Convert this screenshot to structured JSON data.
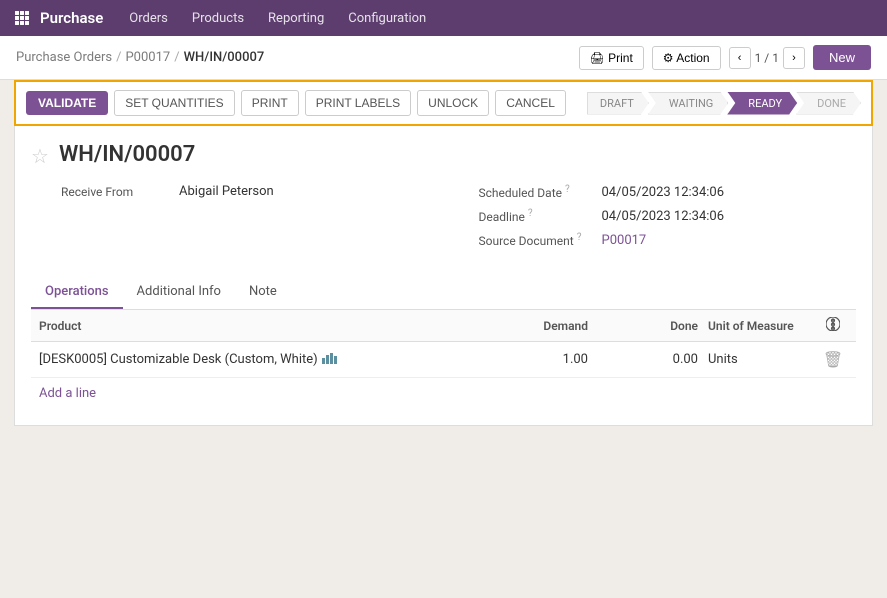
{
  "app": {
    "name": "Purchase"
  },
  "topnav": {
    "items": [
      {
        "label": "Orders",
        "id": "orders"
      },
      {
        "label": "Products",
        "id": "products"
      },
      {
        "label": "Reporting",
        "id": "reporting"
      },
      {
        "label": "Configuration",
        "id": "configuration"
      }
    ]
  },
  "breadcrumb": {
    "items": [
      {
        "label": "Purchase Orders",
        "href": "#"
      },
      {
        "label": "P00017",
        "href": "#"
      },
      {
        "label": "WH/IN/00007"
      }
    ],
    "separator": "/"
  },
  "header_actions": {
    "print_label": "🖨 Print",
    "action_label": "⚙ Action",
    "pager": "1 / 1",
    "new_label": "New"
  },
  "action_buttons": {
    "validate": "VALIDATE",
    "set_quantities": "SET QUANTITIES",
    "print": "PRINT",
    "print_labels": "PRINT LABELS",
    "unlock": "UNLOCK",
    "cancel": "CANCEL"
  },
  "status_pipeline": [
    {
      "label": "DRAFT",
      "state": "draft"
    },
    {
      "label": "WAITING",
      "state": "waiting"
    },
    {
      "label": "READY",
      "state": "active"
    },
    {
      "label": "DONE",
      "state": "done"
    }
  ],
  "record": {
    "title": "WH/IN/00007",
    "receive_from_label": "Receive From",
    "receive_from_value": "Abigail Peterson",
    "scheduled_date_label": "Scheduled Date",
    "scheduled_date_value": "04/05/2023 12:34:06",
    "deadline_label": "Deadline",
    "deadline_value": "04/05/2023 12:34:06",
    "source_document_label": "Source Document",
    "source_document_value": "P00017"
  },
  "tabs": [
    {
      "label": "Operations",
      "id": "operations",
      "active": true
    },
    {
      "label": "Additional Info",
      "id": "additional-info",
      "active": false
    },
    {
      "label": "Note",
      "id": "note",
      "active": false
    }
  ],
  "table": {
    "columns": {
      "product": "Product",
      "demand": "Demand",
      "done": "Done",
      "uom": "Unit of Measure"
    },
    "rows": [
      {
        "product": "[DESK0005] Customizable Desk (Custom, White)",
        "demand": "1.00",
        "done": "0.00",
        "uom": "Units"
      }
    ],
    "add_line_label": "Add a line"
  }
}
